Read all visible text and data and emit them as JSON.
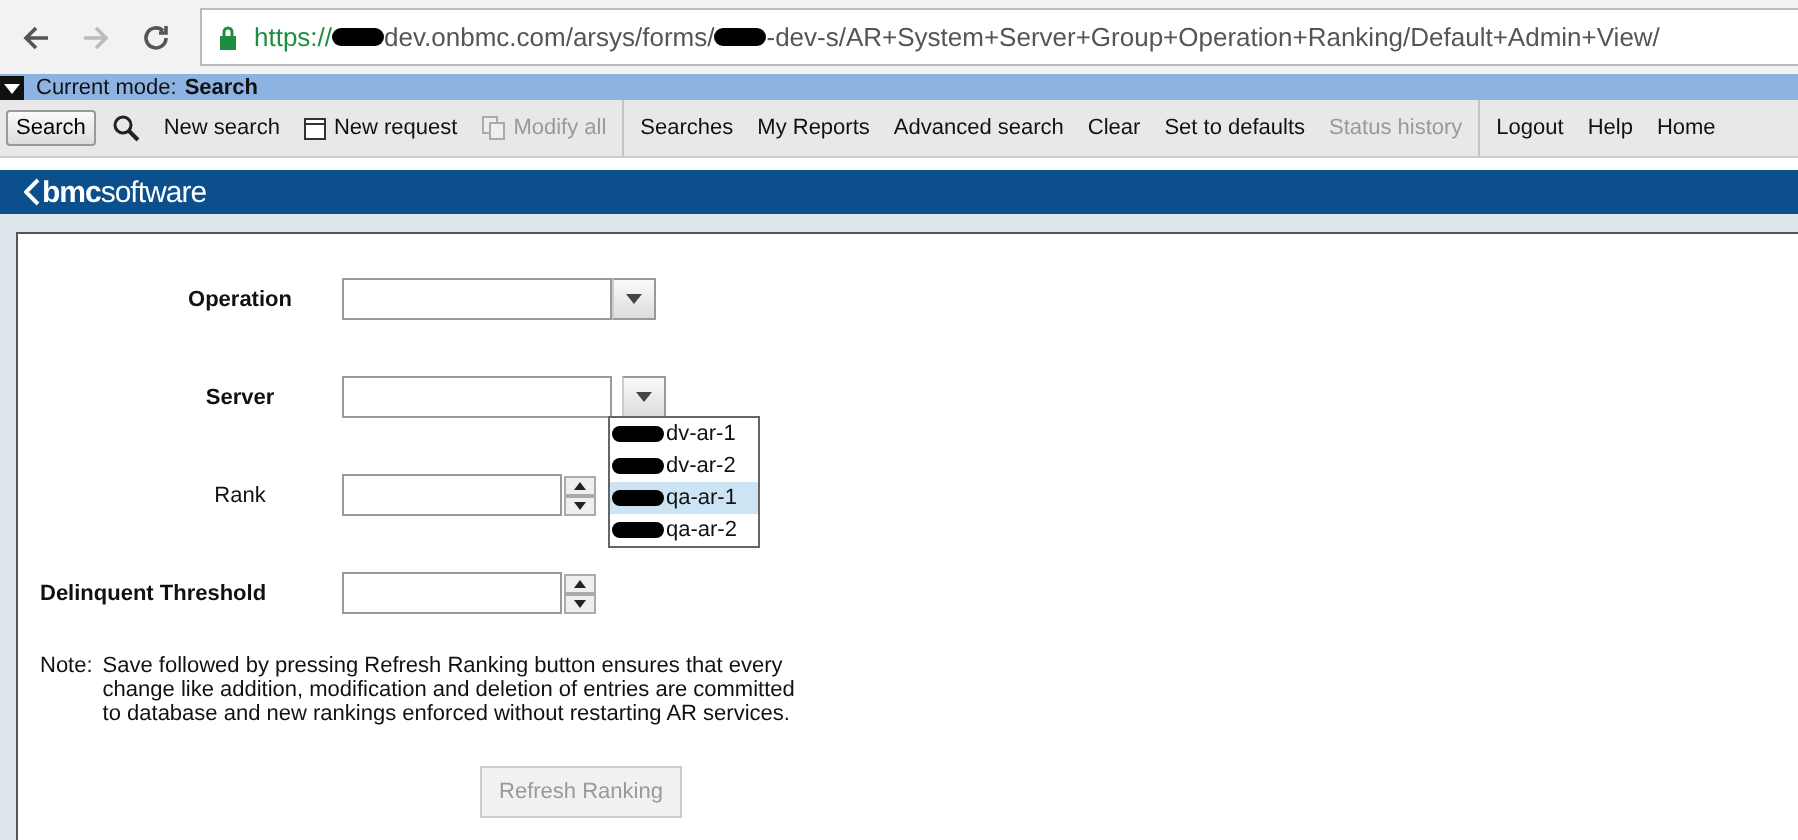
{
  "browser": {
    "url_parts": [
      "https://",
      "dev.onbmc.com/arsys/forms/",
      "-dev-s/AR+System+Server+Group+Operation+Ranking/Default+Admin+View/"
    ]
  },
  "mode_bar": {
    "label": "Current mode:",
    "mode": "Search"
  },
  "toolbar": {
    "groups": [
      [
        {
          "kind": "button",
          "label": "Search",
          "disabled": false
        },
        {
          "kind": "search-icon",
          "disabled": false
        },
        {
          "kind": "link",
          "label": "New search",
          "disabled": false
        },
        {
          "kind": "new",
          "label": "New request",
          "disabled": false
        },
        {
          "kind": "copy",
          "label": "Modify all",
          "disabled": true
        }
      ],
      [
        {
          "kind": "link",
          "label": "Searches",
          "disabled": false
        },
        {
          "kind": "link",
          "label": "My Reports",
          "disabled": false
        },
        {
          "kind": "link",
          "label": "Advanced search",
          "disabled": false
        },
        {
          "kind": "link",
          "label": "Clear",
          "disabled": false
        },
        {
          "kind": "link",
          "label": "Set to defaults",
          "disabled": false
        },
        {
          "kind": "link",
          "label": "Status history",
          "disabled": true
        }
      ],
      [
        {
          "kind": "link",
          "label": "Logout",
          "disabled": false
        },
        {
          "kind": "link",
          "label": "Help",
          "disabled": false
        },
        {
          "kind": "link",
          "label": "Home",
          "disabled": false
        }
      ]
    ]
  },
  "banner": {
    "logo": "**bmc**software"
  },
  "form": {
    "fields": [
      {
        "label": "Operation",
        "bold": true,
        "kind": "dropdown",
        "expanded": false
      },
      {
        "label": "Server",
        "bold": true,
        "kind": "dropdown",
        "expanded": true,
        "options": [
          {
            "label": "dv-ar-1",
            "selected": false
          },
          {
            "label": "dv-ar-2",
            "selected": false
          },
          {
            "label": "qa-ar-1",
            "selected": true
          },
          {
            "label": "qa-ar-2",
            "selected": false
          }
        ]
      },
      {
        "label": "Rank",
        "bold": false,
        "kind": "spinner"
      },
      {
        "label": "Delinquent Threshold",
        "bold": true,
        "kind": "spinner"
      }
    ],
    "note_label": "Note:",
    "note": "Save followed by pressing Refresh Ranking button ensures that every change like addition, modification and deletion of entries are committed to database and new rankings enforced without restarting AR services.",
    "button": {
      "label": "Refresh Ranking",
      "disabled": true
    }
  }
}
